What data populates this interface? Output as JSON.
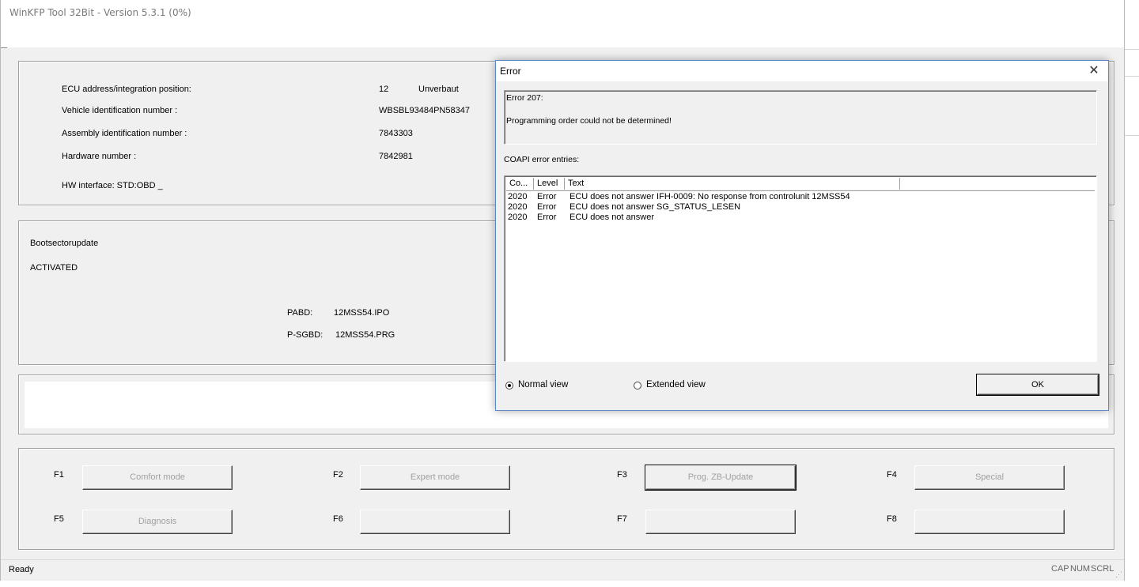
{
  "window": {
    "title": "WinKFP Tool 32Bit - Version 5.3.1 (0%)"
  },
  "ecu_info": {
    "ecu_address_label": "ECU address/integration position:",
    "ecu_address_value": "12",
    "ecu_address_status": "Unverbaut",
    "vin_label": "Vehicle identification number :",
    "vin_value": "WBSBL93484PN58347",
    "assembly_label": "Assembly identification number :",
    "assembly_value": "7843303",
    "hardware_label": "Hardware number :",
    "hardware_value": "7842981",
    "hw_interface": "HW interface:  STD:OBD _"
  },
  "boot": {
    "title": "Bootsectorupdate",
    "status": "ACTIVATED",
    "pabd_label": "PABD:",
    "pabd_value": "12MSS54.IPO",
    "psgbd_label": "P-SGBD:",
    "psgbd_value": "12MSS54.PRG"
  },
  "function_keys": [
    {
      "key": "F1",
      "label": "Comfort mode"
    },
    {
      "key": "F2",
      "label": "Expert mode"
    },
    {
      "key": "F3",
      "label": "Prog. ZB-Update"
    },
    {
      "key": "F4",
      "label": "Special"
    },
    {
      "key": "F5",
      "label": "Diagnosis"
    },
    {
      "key": "F6",
      "label": ""
    },
    {
      "key": "F7",
      "label": ""
    },
    {
      "key": "F8",
      "label": ""
    }
  ],
  "statusbar": {
    "ready": "Ready",
    "cap": "CAP",
    "num": "NUM",
    "scrl": "SCRL"
  },
  "dialog": {
    "title": "Error",
    "close_glyph": "✕",
    "error_code": "Error 207:",
    "error_message": "Programming order could not be determined!",
    "entries_label": "COAPI error entries:",
    "columns": [
      "Co...",
      "Level",
      "Text",
      ""
    ],
    "rows": [
      {
        "code": "2020",
        "level": "Error",
        "text": "ECU does not answer  IFH-0009: No response from controlunit  12MSS54"
      },
      {
        "code": "2020",
        "level": "Error",
        "text": "ECU does not answer  SG_STATUS_LESEN"
      },
      {
        "code": "2020",
        "level": "Error",
        "text": "ECU does not answer"
      }
    ],
    "normal_view": "Normal view",
    "extended_view": "Extended view",
    "ok_label": "OK",
    "selected_view": "Normal view"
  }
}
